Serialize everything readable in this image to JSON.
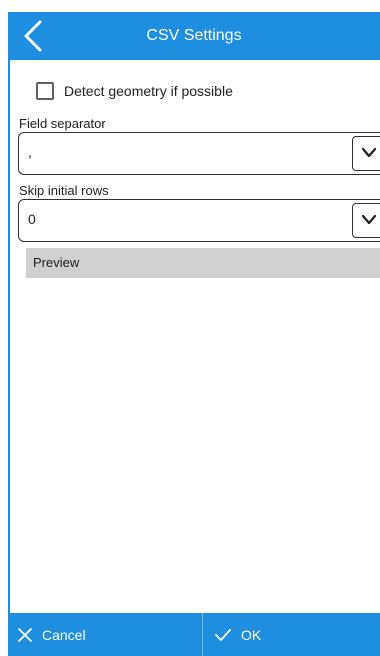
{
  "header": {
    "title": "CSV Settings",
    "back_icon": "chevron-left-icon"
  },
  "detect_geometry": {
    "label": "Detect geometry if possible",
    "checked": false
  },
  "field_separator": {
    "label": "Field separator",
    "value": ","
  },
  "skip_initial_rows": {
    "label": "Skip initial rows",
    "value": "0"
  },
  "preview": {
    "label": "Preview"
  },
  "footer": {
    "cancel_label": "Cancel",
    "ok_label": "OK"
  },
  "colors": {
    "accent": "#1e8ee0",
    "preview_bar": "#d0d0d0"
  }
}
